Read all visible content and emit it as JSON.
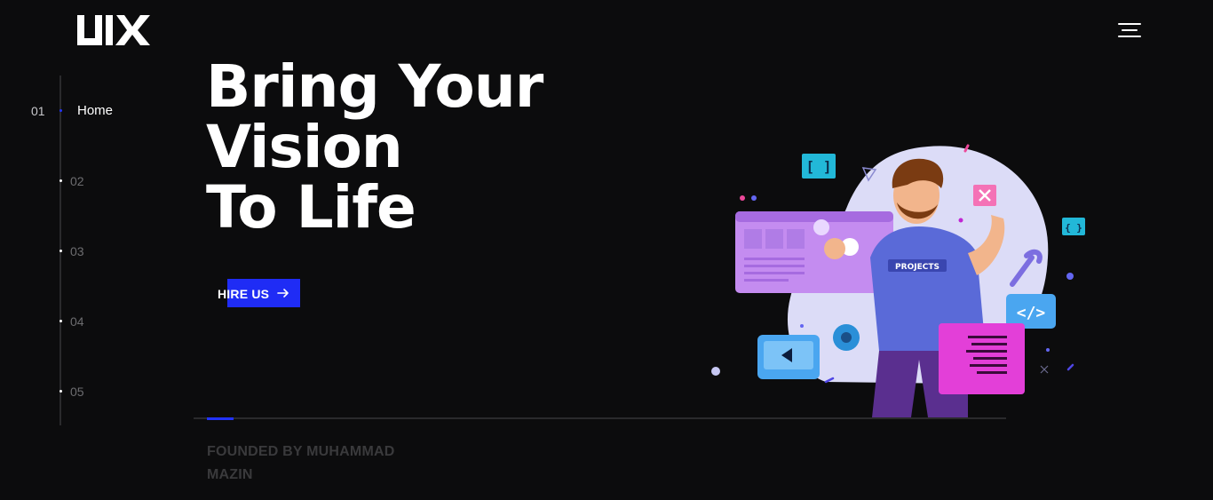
{
  "header": {
    "logo_text": "UIX",
    "menu_icon": "hamburger-icon"
  },
  "slide_nav": {
    "items": [
      {
        "number": "01",
        "label": "Home",
        "active": true
      },
      {
        "number": "02",
        "label": "",
        "active": false
      },
      {
        "number": "03",
        "label": "",
        "active": false
      },
      {
        "number": "04",
        "label": "",
        "active": false
      },
      {
        "number": "05",
        "label": "",
        "active": false
      }
    ]
  },
  "hero": {
    "title_lines": [
      "Bring Your",
      "Vision",
      "To Life"
    ],
    "cta_label": "HIRE US",
    "cta_icon": "arrow-right-icon",
    "progress": 0.033,
    "founded_text": "FOUNDED BY MUHAMMAD MAZIN",
    "illustration_label": "PROJECTS"
  },
  "colors": {
    "background": "#0c0c0d",
    "accent": "#1f2cf5",
    "muted_text": "#3a3a3c"
  }
}
